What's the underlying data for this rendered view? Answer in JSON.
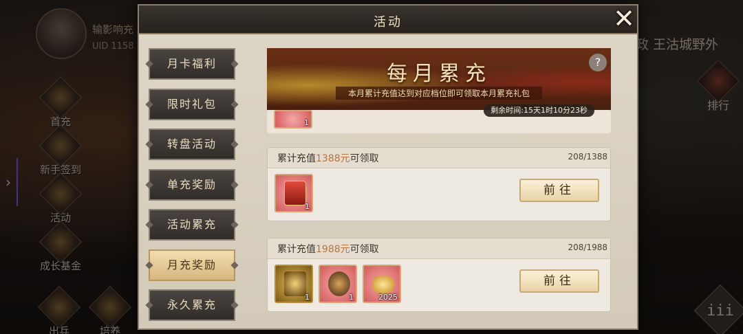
{
  "background": {
    "player": {
      "name": "输影响充",
      "uid": "UID 1158"
    },
    "left_menu": [
      {
        "label": "首充",
        "icon": "gift-icon"
      },
      {
        "label": "新手签到",
        "icon": "scroll-icon"
      },
      {
        "label": "活动",
        "icon": "lantern-icon"
      },
      {
        "label": "成长基金",
        "icon": "treasure-icon"
      }
    ],
    "bottom_menu": [
      {
        "label": "出兵",
        "icon": "army-icon"
      },
      {
        "label": "培养",
        "icon": "sword-icon"
      }
    ],
    "location_text": "政 王沽城野外",
    "rank_label": "排行",
    "menu_glyph": "iii",
    "expand_arrow": "›"
  },
  "dialog": {
    "title": "活动",
    "close_glyph": "✕",
    "nav": [
      {
        "label": "月卡福利",
        "active": false
      },
      {
        "label": "限时礼包",
        "active": false
      },
      {
        "label": "转盘活动",
        "active": false
      },
      {
        "label": "单充奖励",
        "active": false
      },
      {
        "label": "活动累充",
        "active": false
      },
      {
        "label": "月充奖励",
        "active": true
      },
      {
        "label": "永久累充",
        "active": false
      }
    ],
    "banner": {
      "title": "每月累充",
      "subtitle": "本月累计充值达到对应档位即可领取本月累充礼包",
      "help_glyph": "?",
      "timer": "剩余时间:15天1时10分23秒"
    },
    "peek_item_count": "1",
    "tiers": [
      {
        "label_prefix": "累计充值",
        "amount": "1388元",
        "label_suffix": "可领取",
        "progress": "208/1388",
        "button": "前往",
        "items": [
          {
            "icon": "red-scroll-icon",
            "count": "1",
            "style": "red"
          }
        ]
      },
      {
        "label_prefix": "累计充值",
        "amount": "1988元",
        "label_suffix": "可领取",
        "progress": "208/1988",
        "button": "前往",
        "items": [
          {
            "icon": "gold-armor-icon",
            "count": "1",
            "style": "gold"
          },
          {
            "icon": "bronze-seal-icon",
            "count": "1",
            "style": "red"
          },
          {
            "icon": "gold-ingot-icon",
            "count": "2025",
            "style": "red"
          }
        ]
      }
    ]
  },
  "colors": {
    "accent_amount": "#b8733a",
    "active_tab": "#e4c893",
    "banner": "#5a2812"
  }
}
